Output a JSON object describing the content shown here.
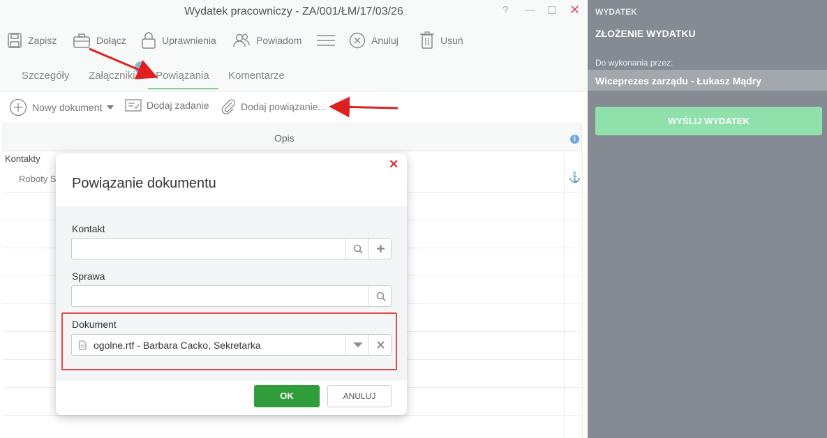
{
  "window": {
    "title": "Wydatek pracowniczy - ZA/001/ŁM/17/03/26",
    "help": "?",
    "minimize": "—",
    "maximize": "☐",
    "close": "✕"
  },
  "toolbar": {
    "save": "Zapisz",
    "attach": "Dołącz",
    "permissions": "Uprawnienia",
    "notify": "Powiadom",
    "cancel": "Anuluj",
    "delete": "Usuń"
  },
  "tabs": [
    "Szczegóły",
    "Załączniki",
    "Powiązania",
    "Komentarze"
  ],
  "active_tab": "Powiązania",
  "actions": {
    "new_document": "Nowy dokument",
    "add_task": "Dodaj zadanie",
    "add_link": "Dodaj powiązanie..."
  },
  "table": {
    "column": "Opis",
    "group": "Kontakty",
    "row": "Roboty S"
  },
  "panel": {
    "caption": "WYDATEK",
    "title": "ZŁOŻENIE WYDATKU",
    "assigned_label": "Do wykonania przez:",
    "assignee": "Wiceprezes zarządu - Łukasz Mądry",
    "send": "WYŚLIJ WYDATEK"
  },
  "modal": {
    "title": "Powiązanie dokumentu",
    "contact_label": "Kontakt",
    "contact_value": "",
    "case_label": "Sprawa",
    "case_value": "",
    "document_label": "Dokument",
    "document_value": "ogolne.rtf - Barbara Cacko, Sekretarka",
    "ok": "OK",
    "cancel": "ANULUJ"
  },
  "colors": {
    "accent_green": "#2f9d3a",
    "panel_gray": "#858b92",
    "send_button": "#8fe0ab",
    "annotation_red": "#e02020"
  }
}
